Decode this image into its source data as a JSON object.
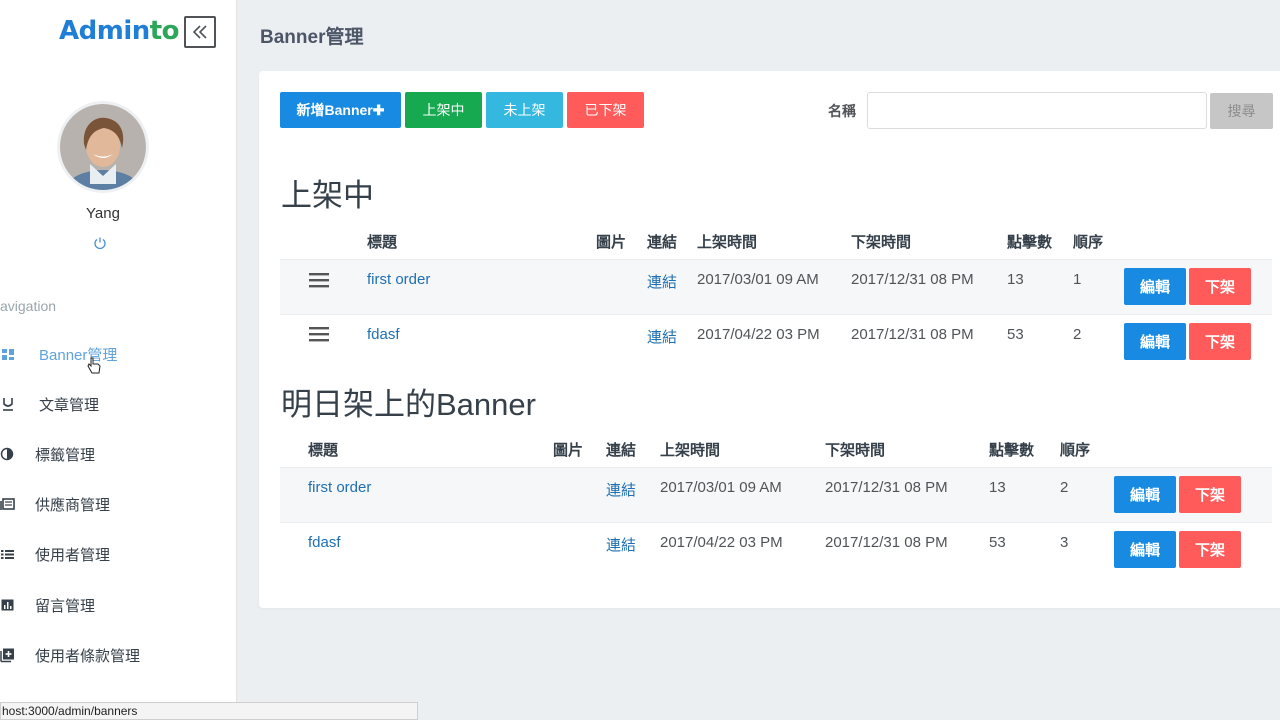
{
  "app": {
    "logo_main": "Admin",
    "logo_accent": "to"
  },
  "header": {
    "page_title": "Banner管理"
  },
  "user": {
    "name": "Yang"
  },
  "sidebar": {
    "heading": "avigation",
    "items": [
      {
        "label": "Banner管理",
        "icon": "dashboard-grid-icon"
      },
      {
        "label": "文章管理",
        "icon": "underline-icon"
      },
      {
        "label": "標籤管理",
        "icon": "contrast-icon"
      },
      {
        "label": "供應商管理",
        "icon": "newspaper-icon"
      },
      {
        "label": "使用者管理",
        "icon": "list-icon"
      },
      {
        "label": "留言管理",
        "icon": "bar-chart-icon"
      },
      {
        "label": "使用者條款管理",
        "icon": "add-box-icon"
      }
    ]
  },
  "toolbar": {
    "add_label": "新增Banner✚",
    "filter_on_label": "上架中",
    "filter_pending_label": "未上架",
    "filter_off_label": "已下架",
    "search_label": "名稱",
    "search_value": "",
    "search_button": "搜尋"
  },
  "section_live": {
    "title": "上架中",
    "columns": [
      "標題",
      "圖片",
      "連結",
      "上架時間",
      "下架時間",
      "點擊數",
      "順序"
    ],
    "rows": [
      {
        "title": "first order",
        "link": "連結",
        "start": "2017/03/01 09 AM",
        "end": "2017/12/31 08 PM",
        "clicks": "13",
        "order": "1",
        "edit": "編輯",
        "off": "下架"
      },
      {
        "title": "fdasf",
        "link": "連結",
        "start": "2017/04/22 03 PM",
        "end": "2017/12/31 08 PM",
        "clicks": "53",
        "order": "2",
        "edit": "編輯",
        "off": "下架"
      }
    ]
  },
  "section_tomorrow": {
    "title": "明日架上的Banner",
    "columns": [
      "標題",
      "圖片",
      "連結",
      "上架時間",
      "下架時間",
      "點擊數",
      "順序"
    ],
    "rows": [
      {
        "title": "first order",
        "link": "連結",
        "start": "2017/03/01 09 AM",
        "end": "2017/12/31 08 PM",
        "clicks": "13",
        "order": "2",
        "edit": "編輯",
        "off": "下架"
      },
      {
        "title": "fdasf",
        "link": "連結",
        "start": "2017/04/22 03 PM",
        "end": "2017/12/31 08 PM",
        "clicks": "53",
        "order": "3",
        "edit": "編輯",
        "off": "下架"
      }
    ]
  },
  "statusbar": {
    "url": "host:3000/admin/banners"
  },
  "colors": {
    "primary": "#188ae2",
    "success": "#17a950",
    "info": "#35b8e0",
    "danger": "#ff5b5b",
    "link": "#1f6fb2"
  }
}
